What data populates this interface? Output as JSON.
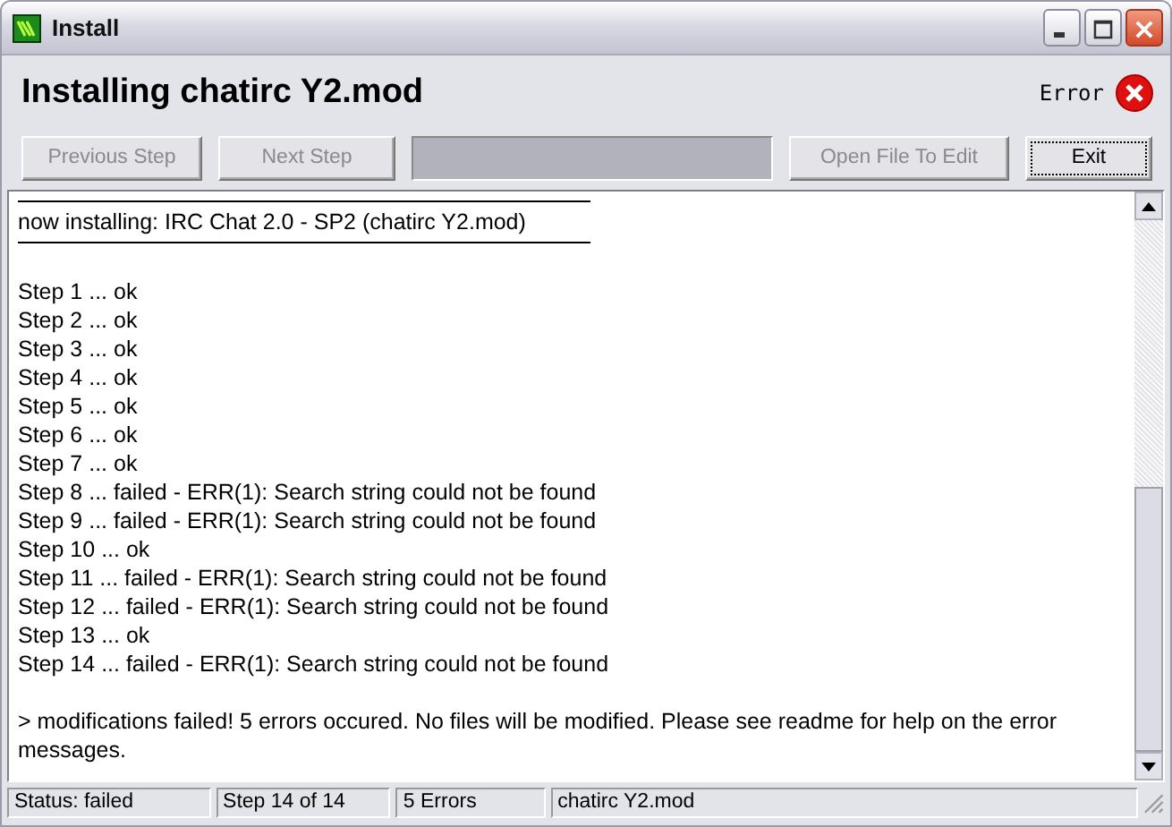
{
  "window": {
    "title": "Install"
  },
  "header": {
    "title": "Installing chatirc Y2.mod",
    "status": "Error"
  },
  "buttons": [
    {
      "label": "Previous Step",
      "disabled": true,
      "kind": "button"
    },
    {
      "label": "Next Step",
      "disabled": true,
      "kind": "button"
    },
    {
      "kind": "panel"
    },
    {
      "label": "Open File To Edit",
      "disabled": true,
      "kind": "button"
    },
    {
      "label": "Exit",
      "disabled": false,
      "kind": "button"
    }
  ],
  "log": [
    {
      "kind": "rule"
    },
    {
      "kind": "text",
      "text": "now installing: IRC Chat 2.0 - SP2 (chatirc Y2.mod)"
    },
    {
      "kind": "rule"
    },
    {
      "kind": "gap"
    },
    {
      "kind": "text",
      "text": "Step 1 ... ok"
    },
    {
      "kind": "text",
      "text": "Step 2 ... ok"
    },
    {
      "kind": "text",
      "text": "Step 3 ... ok"
    },
    {
      "kind": "text",
      "text": "Step 4 ... ok"
    },
    {
      "kind": "text",
      "text": "Step 5 ... ok"
    },
    {
      "kind": "text",
      "text": "Step 6 ... ok"
    },
    {
      "kind": "text",
      "text": "Step 7 ... ok"
    },
    {
      "kind": "text",
      "text": "Step 8 ... failed - ERR(1): Search string could not be found"
    },
    {
      "kind": "text",
      "text": "Step 9 ... failed - ERR(1): Search string could not be found"
    },
    {
      "kind": "text",
      "text": "Step 10 ... ok"
    },
    {
      "kind": "text",
      "text": "Step 11 ... failed - ERR(1): Search string could not be found"
    },
    {
      "kind": "text",
      "text": "Step 12 ... failed - ERR(1): Search string could not be found"
    },
    {
      "kind": "text",
      "text": "Step 13 ... ok"
    },
    {
      "kind": "text",
      "text": "Step 14 ... failed - ERR(1): Search string could not be found"
    },
    {
      "kind": "gap"
    },
    {
      "kind": "text",
      "text": "> modifications failed! 5 errors occured. No files will be modified. Please see readme for help on the error messages."
    }
  ],
  "status_bar": [
    "Status: failed",
    "Step 14 of 14",
    "5 Errors",
    "chatirc Y2.mod"
  ]
}
